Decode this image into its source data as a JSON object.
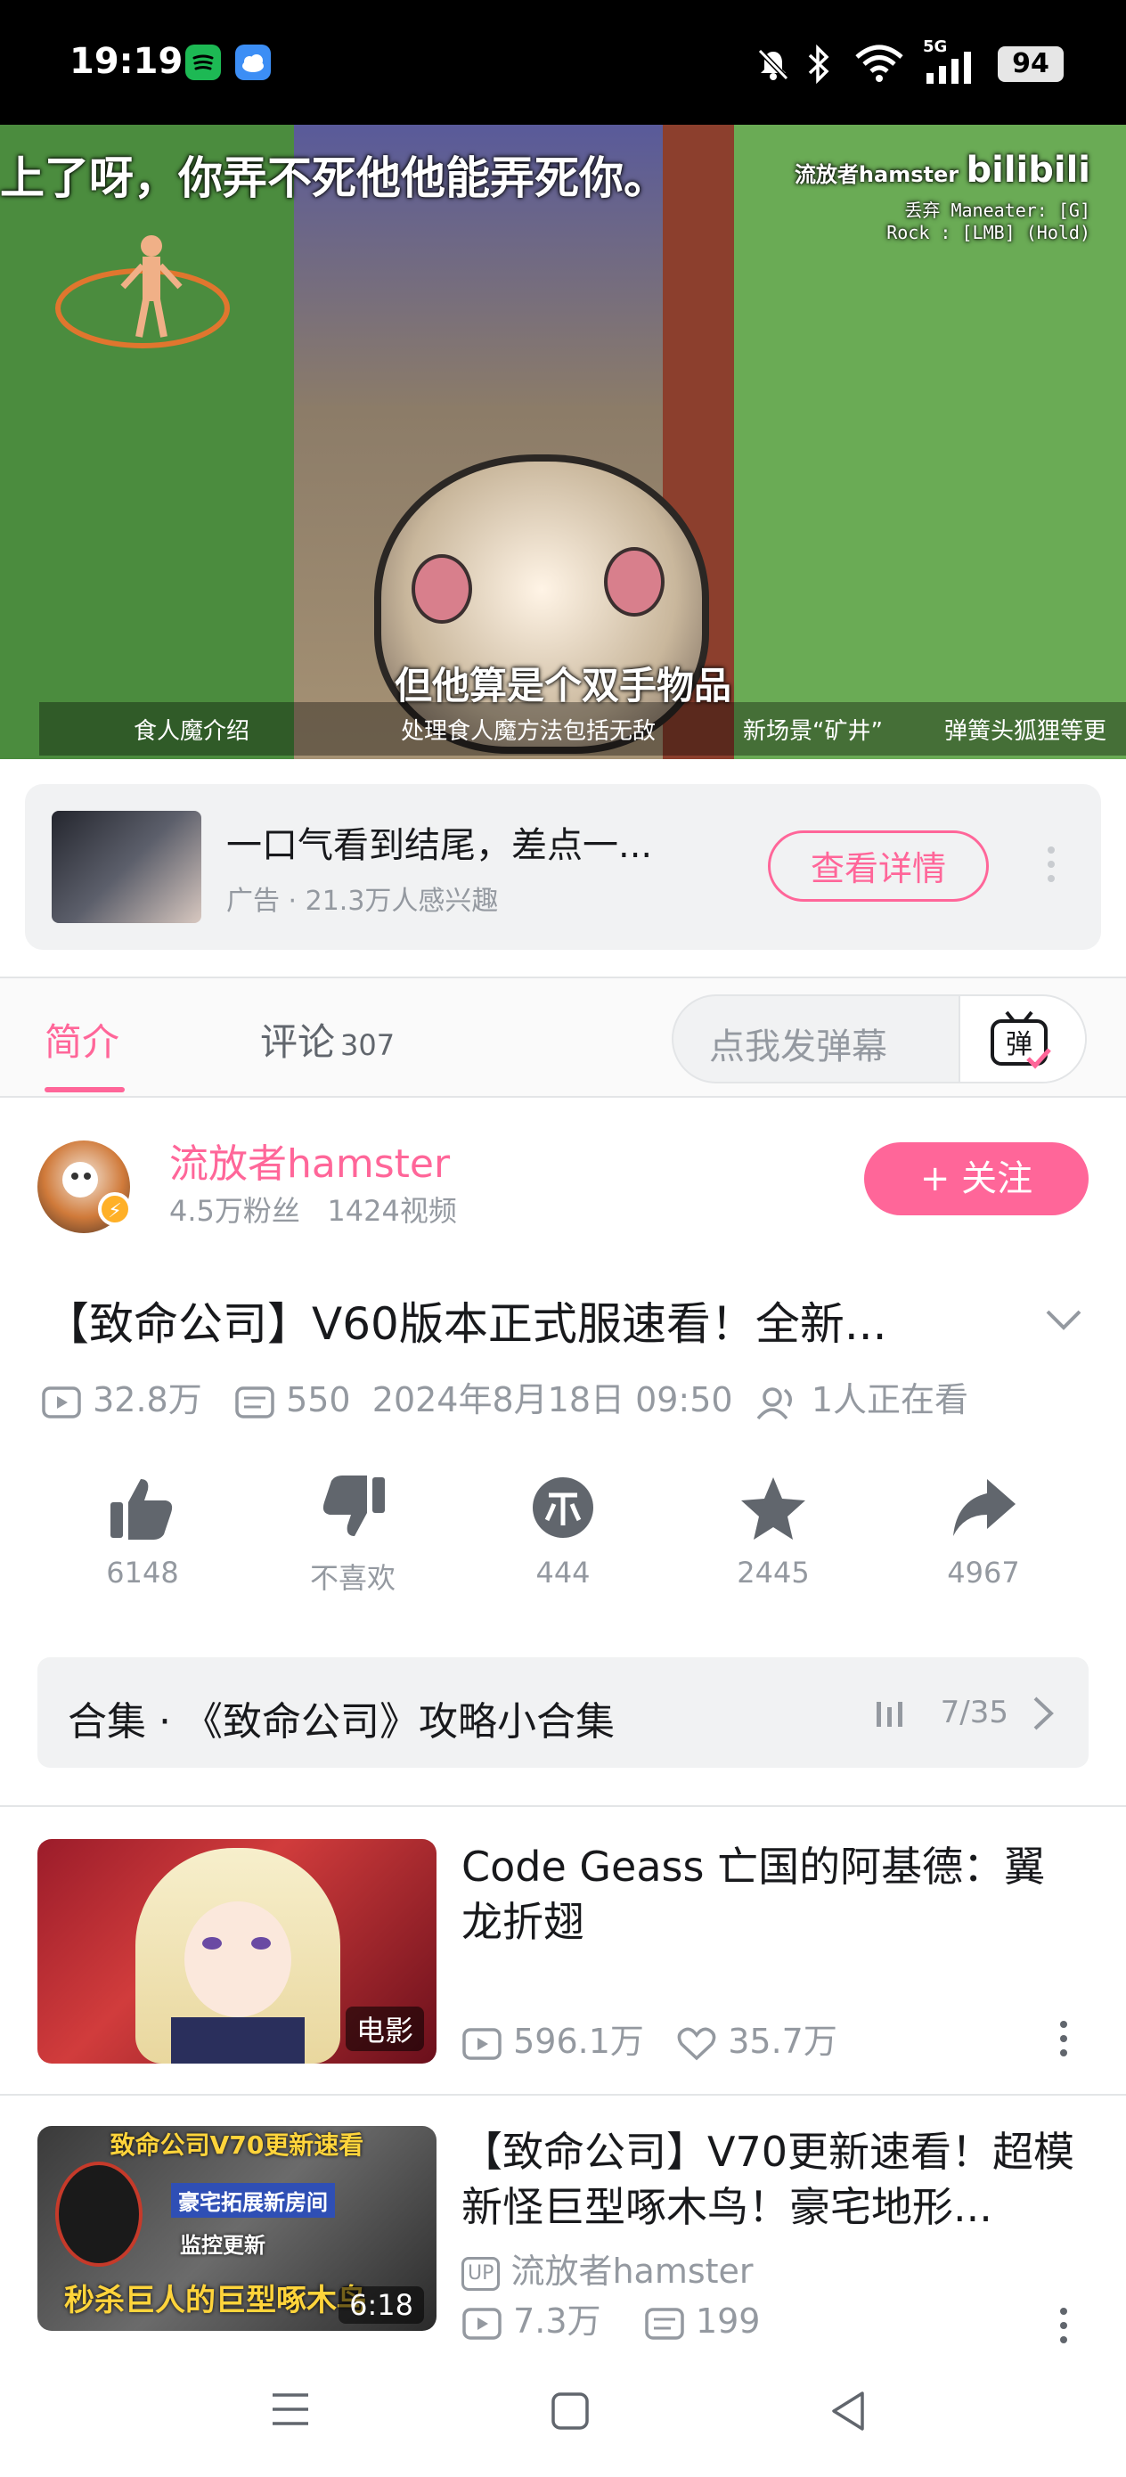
{
  "status_bar": {
    "time": "19:19",
    "battery": "94",
    "network": "5G",
    "app_icons": [
      "spotify-icon",
      "weather-icon"
    ],
    "system_icons": [
      "mute-icon",
      "bluetooth-icon",
      "wifi-icon",
      "signal-icon"
    ]
  },
  "video": {
    "subtitle_top": "上了呀，你弄不死他他能弄死你。",
    "subtitle_main": "但他算是个双手物品",
    "watermark": "流放者hamster",
    "watermark_logo": "bilibili",
    "hud_line1": "丢弃 Maneater: [G]",
    "hud_line2": "Rock : [LMB] (Hold)",
    "chapters": [
      "食人魔介绍",
      "处理食人魔方法包括无敌",
      "新场景“矿井”",
      "弹簧头狐狸等更"
    ]
  },
  "ad": {
    "title": "一口气看到结尾，差点一...",
    "subtitle": "广告 · 21.3万人感兴趣",
    "button": "查看详情"
  },
  "tabs": {
    "intro": "简介",
    "comments": "评论",
    "comments_count": "307",
    "danmu_placeholder": "点我发弹幕",
    "danmu_button": "弹"
  },
  "uploader": {
    "name": "流放者hamster",
    "fans": "4.5万粉丝",
    "videos": "1424视频",
    "follow": "+ 关注"
  },
  "video_info": {
    "title": "【致命公司】V60版本正式服速看！全新...",
    "views": "32.8万",
    "danmaku": "550",
    "date": "2024年8月18日 09:50",
    "watching": "1人正在看"
  },
  "actions": {
    "like": "6148",
    "dislike": "不喜欢",
    "coin": "444",
    "favorite": "2445",
    "share": "4967"
  },
  "collection": {
    "label": "合集 · 《致命公司》攻略小合集",
    "progress": "7/35"
  },
  "recommendations": [
    {
      "title": "Code Geass 亡国的阿基德：翼龙折翅",
      "badge": "电影",
      "views": "596.1万",
      "likes": "35.7万"
    },
    {
      "title": "【致命公司】V70更新速看！超模新怪巨型啄木鸟！豪宅地形...",
      "thumb_text_top": "致命公司V70更新速看",
      "thumb_text_a": "豪宅拓展新房间",
      "thumb_text_b": "监控更新",
      "thumb_text_c": "秒杀巨人的巨型啄木鸟",
      "badge": "6:18",
      "uploader": "流放者hamster",
      "up_tag": "UP",
      "views": "7.3万",
      "danmaku": "199"
    }
  ],
  "colors": {
    "accent": "#ff6699",
    "text_secondary": "#9499a0",
    "panel_bg": "#f1f2f3"
  }
}
